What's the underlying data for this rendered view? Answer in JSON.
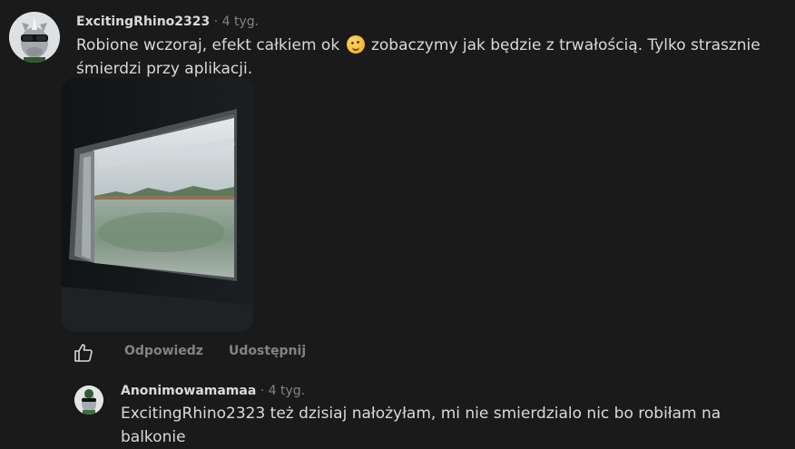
{
  "comment_1": {
    "username": "ExcitingRhino2323",
    "separator": "·",
    "time": "4 tyg.",
    "text_before_emoji": "Robione wczoraj, efekt całkiem ok ",
    "emoji": "winking-face-emoji",
    "text_after_emoji": " zobaczymy jak będzie z trwałością. Tylko strasznie śmierdzi przy aplikacji.",
    "image": "window-with-frosted-film-photo",
    "actions": {
      "like_icon": "thumbs-up-icon",
      "reply_label": "Odpowiedz",
      "share_label": "Udostępnij"
    }
  },
  "comment_2": {
    "username": "Anonimowamamaa",
    "separator": "·",
    "time": "4 tyg.",
    "text": "ExcitingRhino2323 też dzisiaj nałożyłam, mi nie smierdzialo nic bo robiłam na balkonie"
  },
  "colors": {
    "background": "#1a1a1b",
    "text": "#d7dadc",
    "muted": "#818384"
  }
}
